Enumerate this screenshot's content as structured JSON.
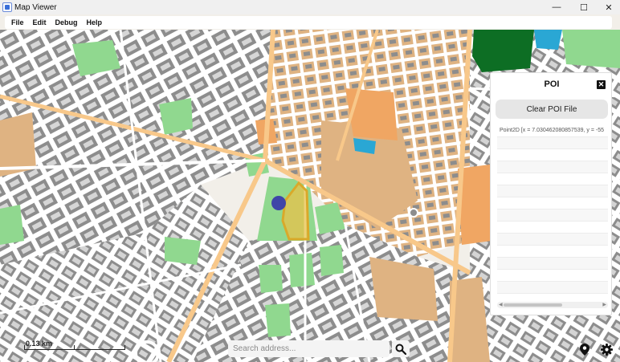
{
  "window": {
    "title": "Map Viewer",
    "controls": {
      "minimize": "—",
      "maximize": "☐",
      "close": "✕"
    }
  },
  "menu": {
    "items": [
      "File",
      "Edit",
      "Debug",
      "Help"
    ]
  },
  "poi": {
    "title": "POI",
    "close_symbol": "✕",
    "clear_button": "Clear POI File",
    "entries": [
      "Point2D [x = 7.030462080857539, y = -55"
    ],
    "scroll_left": "◀",
    "scroll_right": "▶",
    "scroll_position": 0.6
  },
  "scale": {
    "label": "0.13 km"
  },
  "search": {
    "placeholder": "Search address..."
  },
  "colors": {
    "map_background": "#f2efe9",
    "park": "#90d88f",
    "building": "#8d8d8d",
    "road": "#ffffff",
    "major_road": "#f8c88a",
    "commercial": "#dfb382",
    "industrial": "#f0a663",
    "water": "#2aa7d4",
    "forest": "#0d6e24",
    "selected_area": "#e9c24a",
    "poi_marker": "#3f45a8"
  },
  "icons": [
    "search-icon",
    "location-pin-icon",
    "gear-icon",
    "close-icon"
  ]
}
